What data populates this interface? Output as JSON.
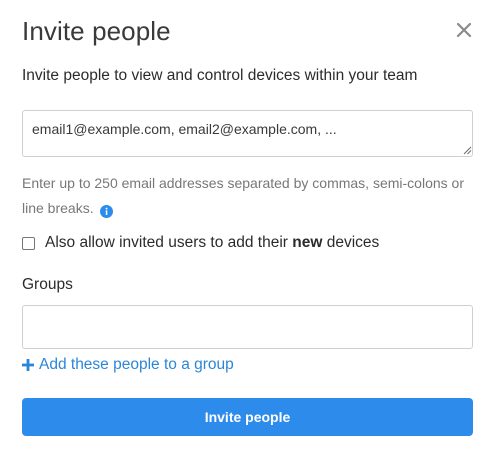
{
  "dialog": {
    "title": "Invite people",
    "close_icon": "close-icon",
    "description": "Invite people to view and control devices within your team"
  },
  "emails": {
    "placeholder": "email1@example.com, email2@example.com, ...",
    "value": ""
  },
  "hint": {
    "text": "Enter up to 250 email addresses separated by commas, semi-colons or line breaks.",
    "info_icon": "info-icon"
  },
  "allow_new_devices": {
    "checked": false,
    "label_before": "Also allow invited users to add their ",
    "label_bold": "new",
    "label_after": " devices"
  },
  "groups": {
    "label": "Groups",
    "value": "",
    "add_link": "Add these people to a group",
    "add_icon": "plus-icon"
  },
  "actions": {
    "invite_label": "Invite people"
  },
  "colors": {
    "accent": "#2d8ceb",
    "link": "#2b86d8",
    "hint_text": "#777777"
  }
}
